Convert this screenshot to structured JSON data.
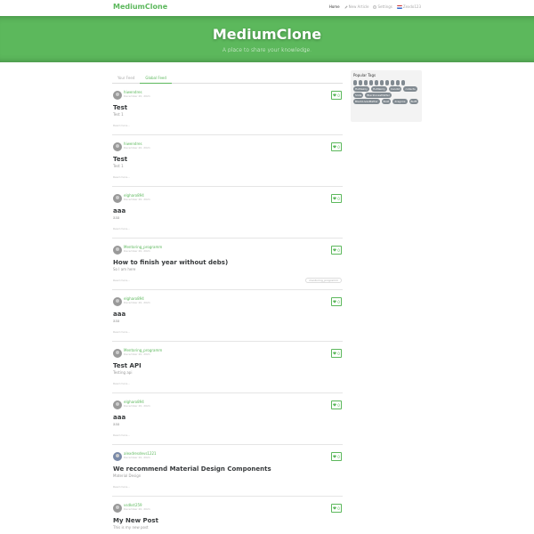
{
  "navbar": {
    "brand": "MediumClone",
    "links": [
      {
        "label": "Home",
        "icon": "",
        "active": true
      },
      {
        "label": "New Article",
        "icon": "pencil-icon",
        "active": false
      },
      {
        "label": "Settings",
        "icon": "gear-icon",
        "active": false
      },
      {
        "label": "Zexdo123",
        "icon": "avatar-flag-icon",
        "active": false
      }
    ]
  },
  "banner": {
    "title": "MediumClone",
    "subtitle": "A place to share your knowledge."
  },
  "tabs": [
    {
      "label": "Your Feed",
      "active": false
    },
    {
      "label": "Global Feed",
      "active": true
    }
  ],
  "articles": [
    {
      "author": "hiwendres",
      "date": "December 20, 2021",
      "favorites": "0",
      "title": "Test",
      "description": "Test 1",
      "read_more": "Read more...",
      "tags": []
    },
    {
      "author": "hiwendres",
      "date": "December 20, 2021",
      "favorites": "0",
      "title": "Test",
      "description": "Test 1",
      "read_more": "Read more...",
      "tags": []
    },
    {
      "author": "elgharo894",
      "date": "December 20, 2021",
      "favorites": "0",
      "title": "aaa",
      "description": "aaa",
      "read_more": "Read more...",
      "tags": []
    },
    {
      "author": "Mentoring_programm",
      "date": "December 20, 2021",
      "favorites": "0",
      "title": "How to finish year without debs)",
      "description": "So I am here",
      "read_more": "Read more...",
      "tags": [
        "mentoring_programm"
      ]
    },
    {
      "author": "elgharo894",
      "date": "December 20, 2021",
      "favorites": "0",
      "title": "aaa",
      "description": "aaa",
      "read_more": "Read more...",
      "tags": []
    },
    {
      "author": "Mentoring_programm",
      "date": "December 20, 2021",
      "favorites": "0",
      "title": "Test API",
      "description": "Testing api",
      "read_more": "Read more...",
      "tags": []
    },
    {
      "author": "elgharo894",
      "date": "December 20, 2021",
      "favorites": "0",
      "title": "aaa",
      "description": "aaa",
      "read_more": "Read more...",
      "tags": []
    },
    {
      "author": "alexdresdevs1221",
      "date": "December 20, 2021",
      "favorites": "0",
      "title": "We recommend Material Design Components",
      "description": "Material Design",
      "read_more": "Read more...",
      "tags": []
    },
    {
      "author": "vsdkst259",
      "date": "December 20, 2021",
      "favorites": "0",
      "title": "My New Post",
      "description": "This is my new post",
      "read_more": "Read more...",
      "tags": []
    }
  ],
  "sidebar": {
    "title": "Popular Tags",
    "tags": [
      "",
      "",
      "",
      "",
      "",
      "",
      "",
      "",
      "",
      "",
      "HuMainly",
      "HuMainly",
      "Candid",
      "collects",
      "Slide",
      "BlackLivesMatter",
      "BlackLivesMatter",
      "Bold",
      "dragons",
      "Buffi"
    ]
  },
  "colors": {
    "accent": "#5cb85c",
    "tag_bg": "#818a91",
    "sidebar_bg": "#f3f3f3"
  }
}
